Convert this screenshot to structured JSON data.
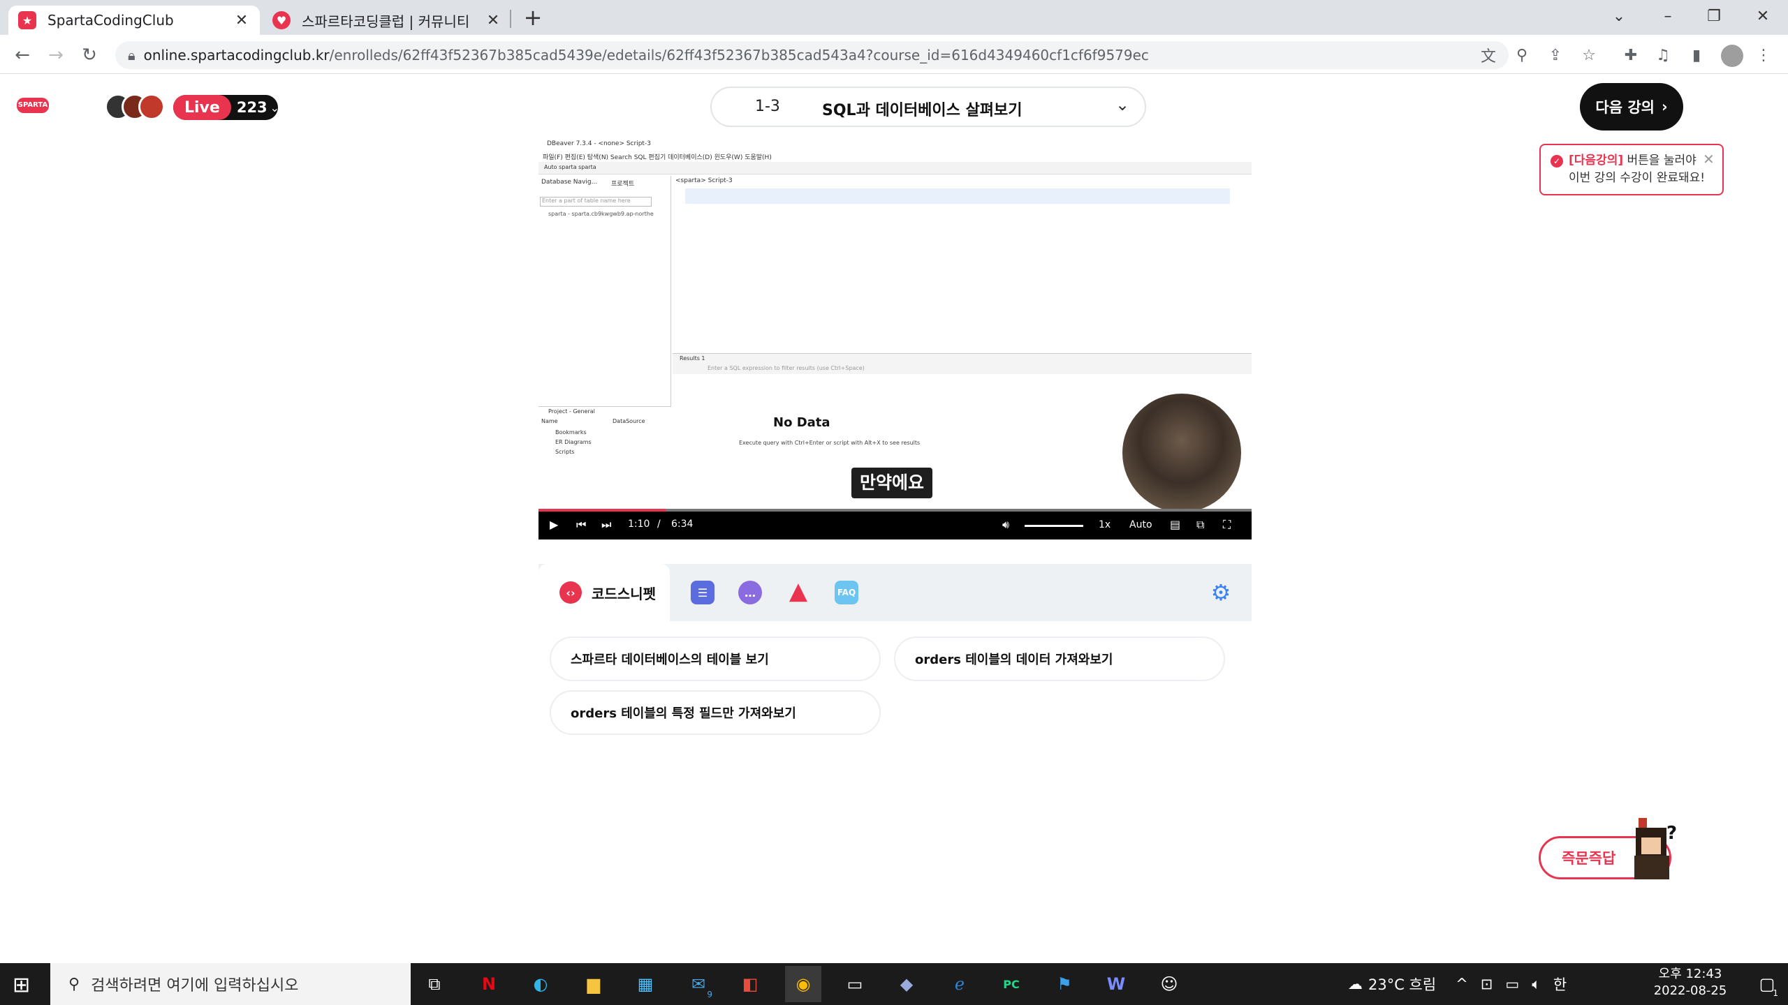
{
  "browser": {
    "tabs": [
      {
        "title": "SpartaCodingClub",
        "active": true
      },
      {
        "title": "스파르타코딩클럽 | 커뮤니티",
        "active": false
      }
    ],
    "url_host": "online.spartacodingclub.kr",
    "url_path": "/enrolleds/62ff43f52367b385cad5439e/edetails/62ff43f52367b385cad543a4?course_id=616d4349460cf1cf6f9579ec"
  },
  "header": {
    "logo_text": "SPARTA",
    "live_label": "Live",
    "live_count": "223",
    "lecture_number": "1-3",
    "lecture_title": "SQL과 데이터베이스 살펴보기",
    "next_button": "다음 강의",
    "tooltip_highlight": "[다음강의]",
    "tooltip_line1": "버튼을 눌러야",
    "tooltip_line2": "이번 강의 수강이 완료돼요!"
  },
  "video": {
    "app_title": "DBeaver 7.3.4 - <none> Script-3",
    "menu": "파일(F)  편집(E)  탐색(N)  Search  SQL 편집기  데이터베이스(D)  윈도우(W)  도움말(H)",
    "toolbar_text": "Auto      sparta      sparta",
    "nav_tab": "Database Navig...",
    "project_tab": "프로젝트",
    "filter_placeholder": "Enter a part of table name here",
    "tree_item": "sparta - sparta.cb9kwgwb9.ap-northe",
    "script_tab": "<sparta> Script-3",
    "results_tab": "Results 1",
    "sql_filter": "Enter a SQL expression to filter results (use Ctrl+Space)",
    "project_title": "Project - General",
    "col_name": "Name",
    "col_ds": "DataSource",
    "project_items": [
      "Bookmarks",
      "ER Diagrams",
      "Scripts"
    ],
    "no_data": "No Data",
    "exec_hint": "Execute query with Ctrl+Enter or script with Alt+X to see results",
    "caption": "만약에요",
    "current_time": "1:10",
    "time_sep": "/",
    "duration": "6:34",
    "speed": "1x",
    "quality": "Auto",
    "progress": 0.178
  },
  "panel": {
    "active_tab": "코드스니펫",
    "faq": "FAQ",
    "snippets": [
      "스파르타 데이터베이스의 테이블 보기",
      "orders 테이블의 데이터 가져와보기",
      "orders 테이블의 특정 필드만 가져와보기"
    ]
  },
  "quick_answer": "즉문즉답",
  "taskbar": {
    "search_placeholder": "검색하려면 여기에 입력하십시오",
    "mail_badge": "9",
    "weather": "23°C  흐림",
    "ime": "한",
    "time": "오후 12:43",
    "date": "2022-08-25",
    "notif_count": "1"
  },
  "colors": {
    "brand": "#e8344e",
    "dark": "#111111"
  }
}
